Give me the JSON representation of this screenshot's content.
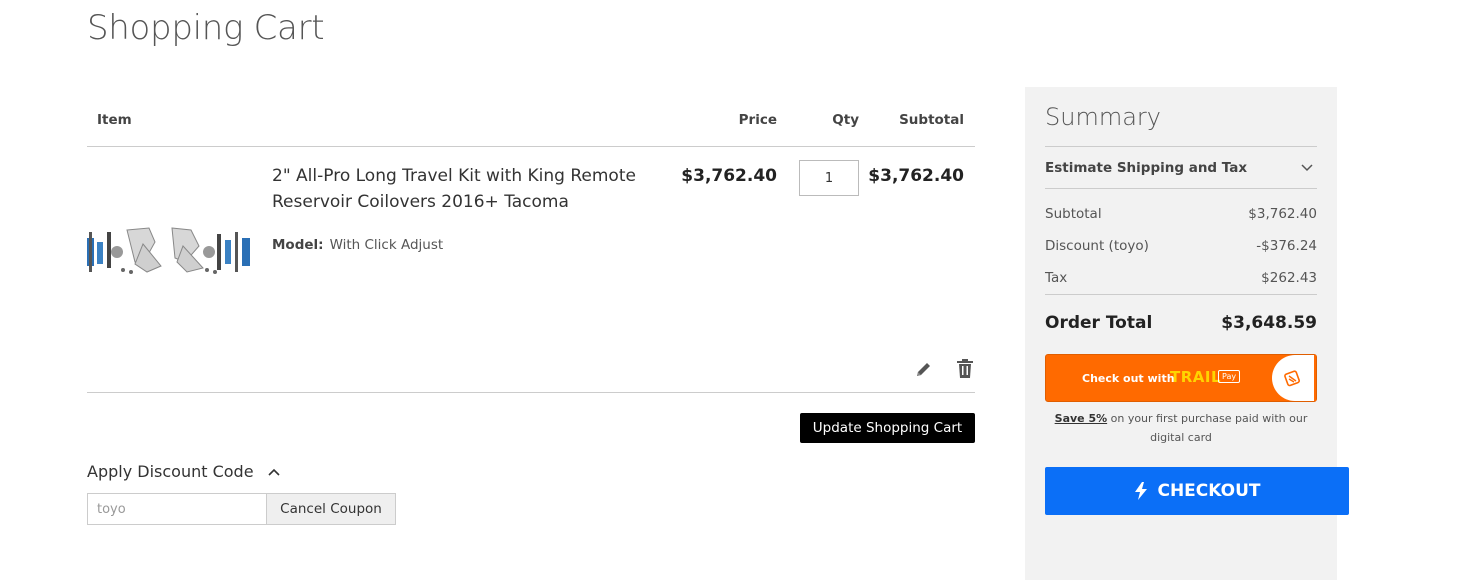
{
  "page_title": "Shopping Cart",
  "cart": {
    "headers": {
      "item": "Item",
      "price": "Price",
      "qty": "Qty",
      "subtotal": "Subtotal"
    },
    "items": [
      {
        "name": "2\" All-Pro Long Travel Kit with King Remote Reservoir Coilovers 2016+ Tacoma",
        "model_label": "Model:",
        "model_value": "With Click Adjust",
        "price": "$3,762.40",
        "qty": "1",
        "subtotal": "$3,762.40"
      }
    ],
    "update_label": "Update Shopping Cart"
  },
  "discount": {
    "toggle_label": "Apply Discount Code",
    "code_value": "toyo",
    "cancel_label": "Cancel Coupon"
  },
  "summary": {
    "title": "Summary",
    "shipping_label": "Estimate Shipping and Tax",
    "lines": [
      {
        "label": "Subtotal",
        "value": "$3,762.40"
      },
      {
        "label": "Discount (toyo)",
        "value": "-$376.24"
      },
      {
        "label": "Tax",
        "value": "$262.43"
      }
    ],
    "order_total_label": "Order Total",
    "order_total_value": "$3,648.59",
    "trail": {
      "text": "Check out with",
      "logo": "TRAIL",
      "pay": "Pay",
      "save_bold": "Save 5%",
      "save_rest": " on your first purchase paid with our digital card"
    },
    "checkout_label": "CHECKOUT"
  },
  "colors": {
    "checkout": "#0b6ff7",
    "trail": "#ff6a00",
    "update_button": "#000000"
  }
}
